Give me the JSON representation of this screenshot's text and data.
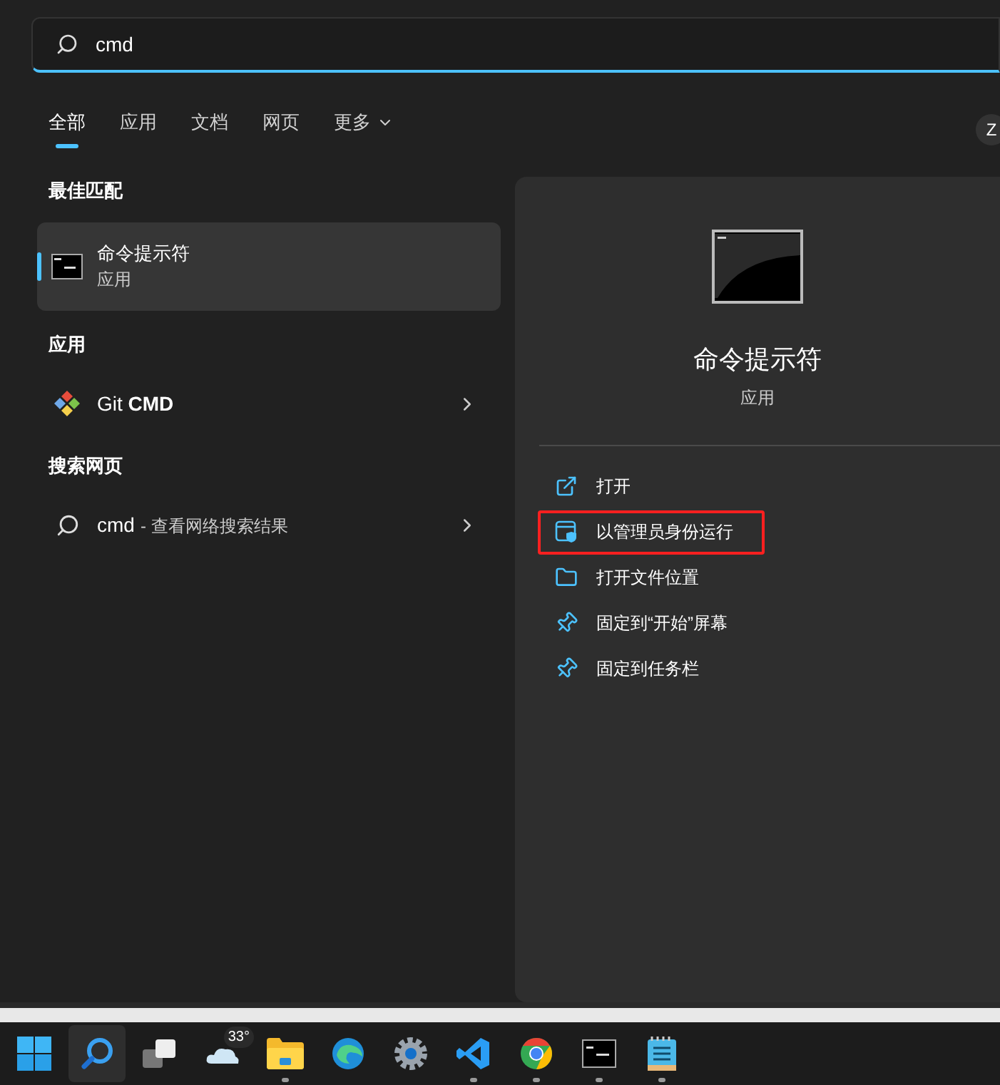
{
  "search": {
    "value": "cmd"
  },
  "tabs": [
    {
      "label": "全部",
      "selected": true,
      "dropdown": false
    },
    {
      "label": "应用",
      "selected": false,
      "dropdown": false
    },
    {
      "label": "文档",
      "selected": false,
      "dropdown": false
    },
    {
      "label": "网页",
      "selected": false,
      "dropdown": false
    },
    {
      "label": "更多",
      "selected": false,
      "dropdown": true
    }
  ],
  "account": {
    "initial": "Z"
  },
  "sections": [
    {
      "heading": "最佳匹配",
      "items": [
        {
          "kind": "best",
          "title": "命令提示符",
          "subtitle": "应用",
          "selected": true
        }
      ]
    },
    {
      "heading": "应用",
      "items": [
        {
          "kind": "app",
          "title": "Git **CMD**",
          "selected": false
        }
      ]
    },
    {
      "heading": "搜索网页",
      "items": [
        {
          "kind": "web",
          "title": "cmd",
          "suffix": "- 查看网络搜索结果",
          "selected": false
        }
      ]
    }
  ],
  "details": {
    "title": "命令提示符",
    "subtitle": "应用",
    "actions": [
      {
        "kind": "open",
        "label": "打开",
        "highlighted": false
      },
      {
        "kind": "admin",
        "label": "以管理员身份运行",
        "highlighted": true
      },
      {
        "kind": "folder",
        "label": "打开文件位置",
        "highlighted": false
      },
      {
        "kind": "pin",
        "label": "固定到“开始”屏幕",
        "highlighted": false
      },
      {
        "kind": "pin",
        "label": "固定到任务栏",
        "highlighted": false
      }
    ]
  },
  "taskbar": [
    {
      "kind": "start",
      "active": false,
      "running": false
    },
    {
      "kind": "search",
      "active": true,
      "running": false
    },
    {
      "kind": "taskview",
      "active": false,
      "running": false
    },
    {
      "kind": "weather",
      "badge": "33°",
      "active": false,
      "running": false
    },
    {
      "kind": "explorer",
      "active": false,
      "running": true
    },
    {
      "kind": "edge",
      "active": false,
      "running": false
    },
    {
      "kind": "settings",
      "active": false,
      "running": false
    },
    {
      "kind": "vscode",
      "active": false,
      "running": true
    },
    {
      "kind": "chrome",
      "active": false,
      "running": true
    },
    {
      "kind": "terminal",
      "active": false,
      "running": true
    },
    {
      "kind": "notepad",
      "active": false,
      "running": true
    }
  ]
}
